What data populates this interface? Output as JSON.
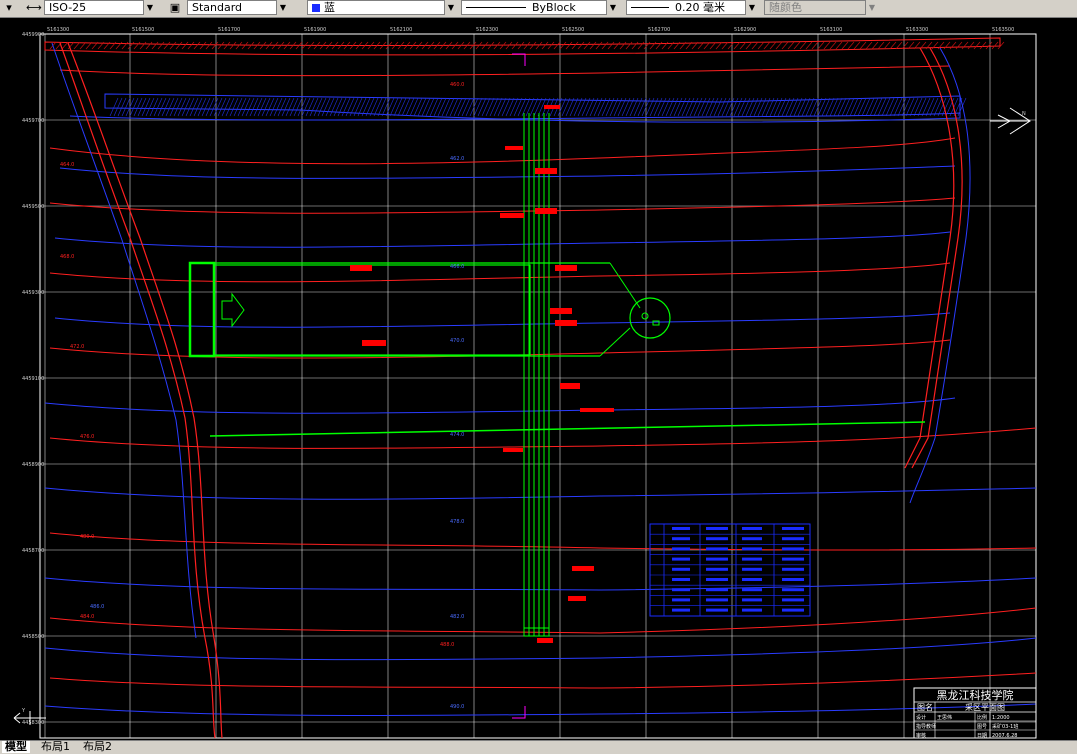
{
  "toolbar": {
    "dimstyle": "ISO-25",
    "textstyle": "Standard",
    "color": "蓝",
    "linetype": "ByBlock",
    "lineweight": "0.20 毫米",
    "plotstyle": "随颜色"
  },
  "tabs": [
    "模型",
    "布局1",
    "布局2"
  ],
  "colors": {
    "background": "#000000",
    "grid": "#ffffff",
    "contour_red": "#ff2020",
    "contour_blue": "#2a3cff",
    "pipe": "#00ff00",
    "label_box": "#ff0000",
    "table": "#1a2cff"
  },
  "drawing": {
    "top_coords": [
      "5161300",
      "5161500",
      "5161700",
      "5161900",
      "5162100",
      "5162300",
      "5162500",
      "5162700",
      "5162900",
      "5163100",
      "5163300",
      "5163500"
    ],
    "left_coords": [
      "4459900",
      "4459700",
      "4459500",
      "4459300",
      "4459100",
      "4458900",
      "4458700",
      "4458500",
      "4458300"
    ],
    "compass_label": "N",
    "ucs_label": "Y",
    "contour_labels_red": [
      "460.0",
      "464.0",
      "468.0",
      "472.0",
      "476.0",
      "480.0",
      "484.0",
      "488.0"
    ],
    "contour_labels_blue": [
      "462.0",
      "466.0",
      "470.0",
      "474.0",
      "478.0",
      "482.0",
      "486.0",
      "490.0"
    ],
    "title_block": {
      "institution": "黑龙江科技学院",
      "drawing_name_label": "图名",
      "drawing_name": "采区平面图",
      "rows": [
        [
          "设计",
          "王思伟",
          "比例",
          "1:2000"
        ],
        [
          "指导教师",
          "",
          "图号",
          "采矿03-1班"
        ],
        [
          "审核",
          "",
          "日期",
          "2007.6.28"
        ]
      ]
    }
  }
}
